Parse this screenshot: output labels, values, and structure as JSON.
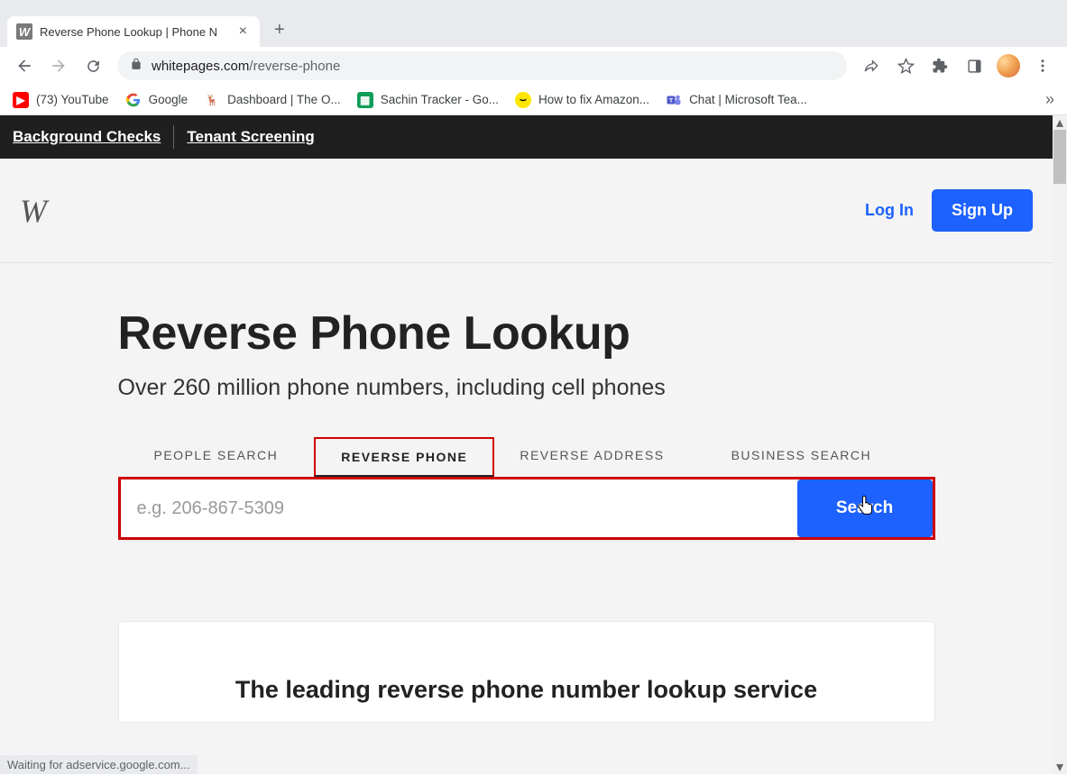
{
  "window": {
    "tab_title": "Reverse Phone Lookup | Phone N"
  },
  "browser": {
    "url_domain": "whitepages.com",
    "url_path": "/reverse-phone"
  },
  "bookmarks": [
    {
      "label": "(73) YouTube"
    },
    {
      "label": "Google"
    },
    {
      "label": "Dashboard | The O..."
    },
    {
      "label": "Sachin Tracker - Go..."
    },
    {
      "label": "How to fix Amazon..."
    },
    {
      "label": "Chat | Microsoft Tea..."
    }
  ],
  "topnav": {
    "link1": "Background Checks",
    "link2": "Tenant Screening"
  },
  "header": {
    "login": "Log In",
    "signup": "Sign Up"
  },
  "main": {
    "heading": "Reverse Phone Lookup",
    "subheading": "Over 260 million phone numbers, including cell phones",
    "tabs": {
      "people": "PEOPLE SEARCH",
      "reverse_phone": "REVERSE PHONE",
      "reverse_address": "REVERSE ADDRESS",
      "business": "BUSINESS SEARCH"
    },
    "search": {
      "placeholder": "e.g. 206-867-5309",
      "button": "Search"
    },
    "card_title": "The leading reverse phone number lookup service"
  },
  "status_bar": "Waiting for adservice.google.com..."
}
